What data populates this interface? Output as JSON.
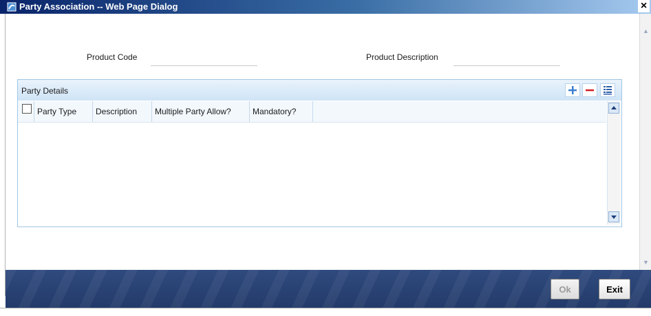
{
  "window": {
    "title": "Party Association -- Web Page Dialog",
    "close_glyph": "×",
    "icon": "ie-page-icon"
  },
  "form": {
    "product_code_label": "Product Code",
    "product_code_value": "",
    "product_description_label": "Product Description",
    "product_description_value": ""
  },
  "party_details": {
    "title": "Party Details",
    "toolbar": {
      "add_icon": "plus-icon",
      "delete_icon": "minus-icon",
      "view_icon": "list-view-icon"
    },
    "columns": [
      "Party Type",
      "Description",
      "Multiple Party Allow?",
      "Mandatory?"
    ],
    "rows": []
  },
  "footer": {
    "ok_label": "Ok",
    "ok_enabled": false,
    "exit_label": "Exit"
  },
  "colors": {
    "title_bar": "#0a246a",
    "panel_border": "#9ec6e6",
    "footer": "#2a4475"
  }
}
